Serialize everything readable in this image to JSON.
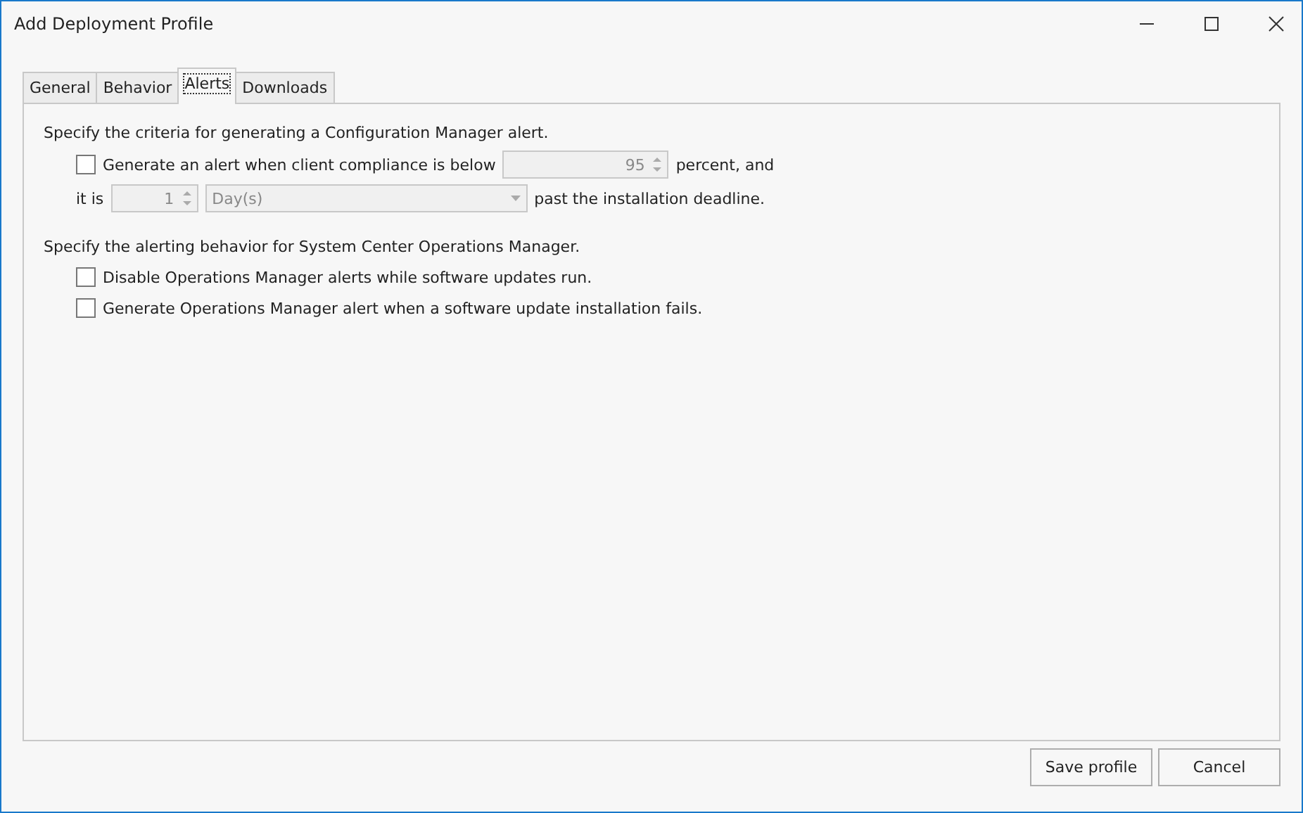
{
  "window": {
    "title": "Add Deployment Profile"
  },
  "tabs": [
    {
      "label": "General",
      "selected": false
    },
    {
      "label": "Behavior",
      "selected": false
    },
    {
      "label": "Alerts",
      "selected": true
    },
    {
      "label": "Downloads",
      "selected": false
    }
  ],
  "config_alert": {
    "heading": "Specify the criteria for generating a Configuration Manager alert.",
    "checkbox": {
      "label": "Generate an alert when client compliance is below",
      "checked": false
    },
    "percent_field": {
      "value": "95",
      "disabled": true
    },
    "percent_suffix": "percent, and",
    "prefix": "it is",
    "count_field": {
      "value": "1",
      "disabled": true
    },
    "unit_dropdown": {
      "value": "Day(s)",
      "disabled": true
    },
    "suffix": "past the installation deadline."
  },
  "scom": {
    "heading": "Specify the alerting behavior for System Center Operations Manager.",
    "options": [
      {
        "label": "Disable Operations Manager alerts while software updates run.",
        "checked": false
      },
      {
        "label": "Generate Operations Manager alert when a software update installation fails.",
        "checked": false
      }
    ]
  },
  "buttons": [
    "Save profile",
    "Cancel"
  ]
}
